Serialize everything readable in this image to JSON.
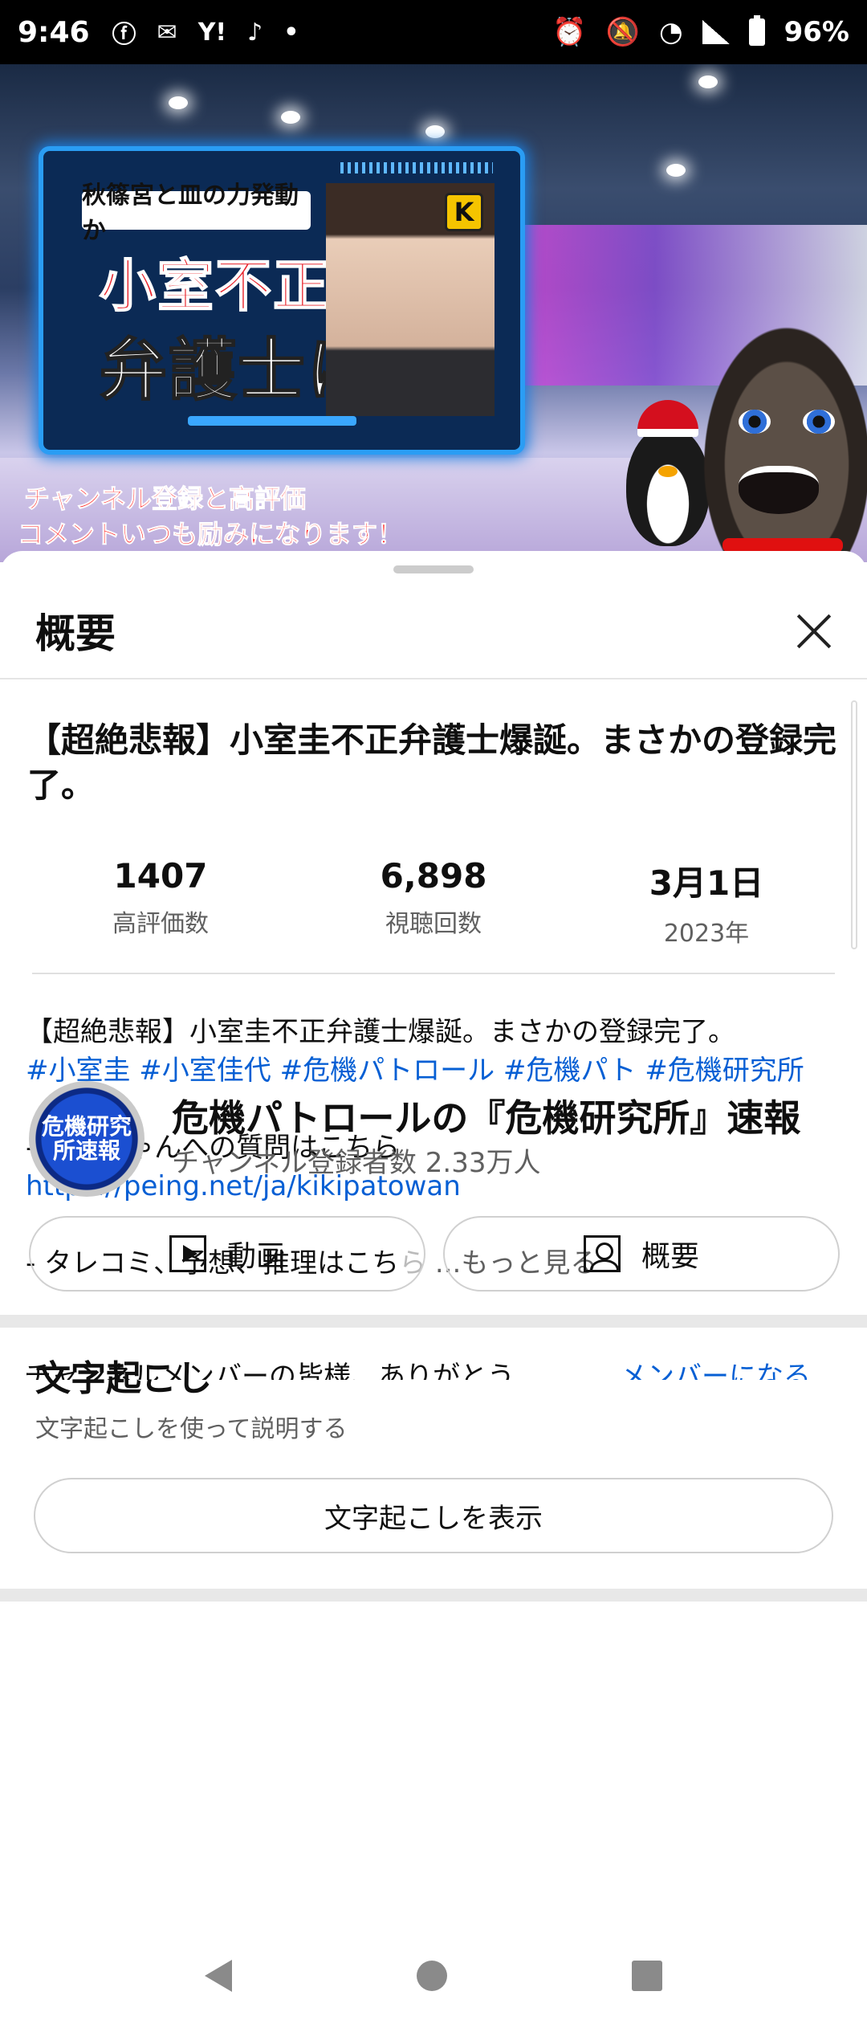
{
  "status_bar": {
    "time": "9:46",
    "battery": "96%",
    "icons": [
      "facebook-icon",
      "yahoo-mail-icon",
      "yahoo-icon",
      "guitar-icon",
      "dot-icon",
      "alarm-icon",
      "bell-off-icon",
      "wifi-icon",
      "signal-icon",
      "battery-icon"
    ],
    "yahoo_label": "Y!"
  },
  "video": {
    "thumb_tag": "秋篠宮と皿の力発動か",
    "thumb_big1": "小室不正",
    "thumb_big2": "弁護士に",
    "thumb_badge": "K",
    "promo_line1": "チャンネル登録と高評価",
    "promo_line2": "コメントいつも励みになります！"
  },
  "sheet": {
    "title": "概要",
    "video_title": "【超絶悲報】小室圭不正弁護士爆誕。まさかの登録完了。",
    "stats": [
      {
        "num": "1407",
        "label": "高評価数"
      },
      {
        "num": "6,898",
        "label": "視聴回数"
      },
      {
        "num": "3月1日",
        "label": "2023年"
      }
    ],
    "description": {
      "line1": "【超絶悲報】小室圭不正弁護士爆誕。まさかの登録完了。",
      "hashtags": "#小室圭 #小室佳代 #危機パトロール #危機パト #危機研究所",
      "line3": "- パトちゃんへの質問はこちら",
      "url": "https://peing.net/ja/kikipatowan",
      "line5": "- タレコミ、予想、推理はこち",
      "line5_fade": "ら",
      "more": "...もっと見る"
    },
    "transcript": {
      "title": "文字起こし",
      "subtitle": "文字起こしを使って説明する",
      "button": "文字起こしを表示"
    },
    "channel": {
      "avatar_text": "危機研究所速報",
      "name": "危機パトロールの『危機研究所』速報",
      "subs": "チャンネル登録者数 2.33万人",
      "videos_button": "動画",
      "about_button": "概要",
      "member_text": "チャンネルメンバーの皆様、ありがとう",
      "join_link": "メンバーになる"
    }
  },
  "navbar": {
    "icons": [
      "back-icon",
      "home-icon",
      "recents-icon"
    ]
  }
}
